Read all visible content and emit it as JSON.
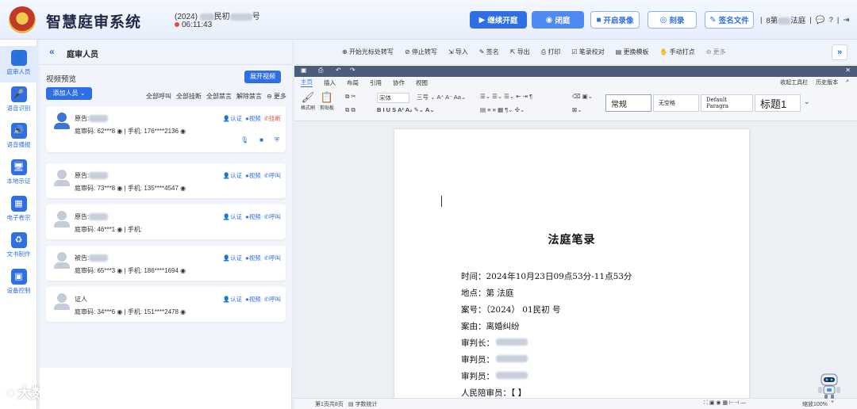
{
  "header": {
    "app_title": "智慧庭审系统",
    "case_prefix": "(2024)",
    "case_mid": "民初",
    "case_suffix": "号",
    "timer": "06:11:43",
    "buttons": {
      "resume": "继续开庭",
      "adjourn": "闭庭",
      "record": "开启录像",
      "notes": "刻录",
      "sign": "签名文件"
    },
    "user_prefix": "8第",
    "user_suffix": "法庭",
    "sep": "|"
  },
  "nav": {
    "items": [
      {
        "label": "庭审人员",
        "icon": "👤"
      },
      {
        "label": "语音识别",
        "icon": "🎤"
      },
      {
        "label": "语音播报",
        "icon": "🔊"
      },
      {
        "label": "本地示证",
        "icon": "🖥"
      },
      {
        "label": "电子卷宗",
        "icon": "▦"
      },
      {
        "label": "文书制作",
        "icon": "♻"
      },
      {
        "label": "设备控制",
        "icon": "▣"
      }
    ]
  },
  "watermark": "大数跨境",
  "left_panel": {
    "title": "庭审人员",
    "collapse": "«",
    "video_preview": "视频预览",
    "expand_video": "展开视频",
    "add_person": "添加人员",
    "bulk_actions": [
      "全部呼叫",
      "全部挂断",
      "全部禁言",
      "解除禁言",
      "⊖ 更多"
    ],
    "cards": [
      {
        "role": "原告:",
        "code": "庭审码: 62***8",
        "phone": "手机: 176****2136",
        "actions": [
          "认证",
          "视频",
          "挂断"
        ],
        "last_red": true
      },
      {
        "role": "原告:",
        "code": "庭审码: 73***8",
        "phone": "手机: 135****4547",
        "actions": [
          "认证",
          "视频",
          "呼叫"
        ],
        "last_red": false
      },
      {
        "role": "原告:",
        "code": "庭审码: 46***1",
        "phone": "手机:",
        "actions": [
          "认证",
          "视频",
          "呼叫"
        ],
        "last_red": false
      },
      {
        "role": "被告:",
        "code": "庭审码: 65***3",
        "phone": "手机: 186****1694",
        "actions": [
          "认证",
          "视频",
          "呼叫"
        ],
        "last_red": false
      },
      {
        "role": "证人",
        "code": "庭审码: 34***6",
        "phone": "手机: 151****2478",
        "actions": [
          "认证",
          "视频",
          "呼叫"
        ],
        "last_red": false
      }
    ]
  },
  "editor": {
    "toolbar": [
      "开始光标处转写",
      "停止转写",
      "导入",
      "签名",
      "导出",
      "打印",
      "笔录校对",
      "更换模板",
      "手动打点",
      "更多"
    ],
    "expand": "»",
    "tabs": [
      "主页",
      "插入",
      "布局",
      "引用",
      "协作",
      "视图"
    ],
    "ribbon_right": [
      "收起工具栏",
      "历史版本"
    ],
    "ribbon_small": {
      "font": "宋体",
      "size": "三号",
      "paste": "格式刷",
      "clip": "剪贴板"
    },
    "styles": [
      "常规",
      "无空格",
      "Default Paragra",
      "标题1"
    ],
    "document": {
      "title": "法庭笔录",
      "lines": [
        "时间：2024年10月23日09点53分-11点53分",
        "地点：第   法庭",
        "案号：（2024）   01民初       号",
        "案由：离婚纠纷",
        "审判长：",
        "审判员：",
        "审判员：",
        "人民陪审员：【                 】"
      ]
    },
    "status": {
      "page": "第1页共8页",
      "words": "字数统计",
      "zoom": "缩放100%"
    }
  }
}
